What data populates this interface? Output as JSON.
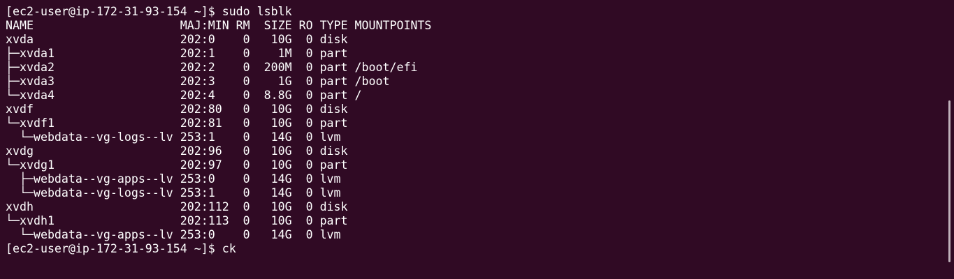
{
  "terminal": {
    "background": "#300a24",
    "foreground": "#ffffff",
    "lines": [
      "[ec2-user@ip-172-31-93-154 ~]$ sudo lsblk",
      "NAME                     MAJ:MIN RM  SIZE RO TYPE MOUNTPOINTS",
      "xvda                     202:0    0   10G  0 disk",
      "├─xvda1                  202:1    0    1M  0 part",
      "├─xvda2                  202:2    0  200M  0 part /boot/efi",
      "├─xvda3                  202:3    0    1G  0 part /boot",
      "└─xvda4                  202:4    0  8.8G  0 part /",
      "xvdf                     202:80   0   10G  0 disk",
      "└─xvdf1                  202:81   0   10G  0 part",
      "  └─webdata--vg-logs--lv 253:1    0   14G  0 lvm",
      "xvdg                     202:96   0   10G  0 disk",
      "└─xvdg1                  202:97   0   10G  0 part",
      "  ├─webdata--vg-apps--lv 253:0    0   14G  0 lvm",
      "  └─webdata--vg-logs--lv 253:1    0   14G  0 lvm",
      "xvdh                     202:112  0   10G  0 disk",
      "└─xvdh1                  202:113  0   10G  0 part",
      "  └─webdata--vg-apps--lv 253:0    0   14G  0 lvm",
      "[ec2-user@ip-172-31-93-154 ~]$ ck"
    ]
  }
}
